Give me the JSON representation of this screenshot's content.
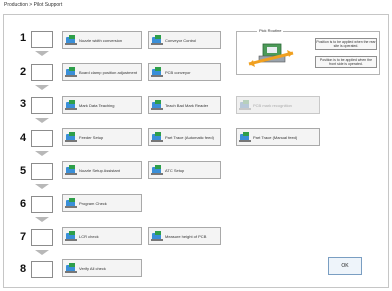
{
  "window": {
    "title": "Production > Pilot Support"
  },
  "steps": [
    {
      "number": "1"
    },
    {
      "number": "2"
    },
    {
      "number": "3"
    },
    {
      "number": "4"
    },
    {
      "number": "5"
    },
    {
      "number": "6"
    },
    {
      "number": "7"
    },
    {
      "number": "8"
    }
  ],
  "buttons": {
    "nozzle_camera": {
      "label": "Nozzle width conversion",
      "icon": "nozzle-camera-icon"
    },
    "conveyor_control": {
      "label": "Conveyor Control",
      "icon": "conveyor-icon"
    },
    "board_clamp": {
      "label": "Board clamp position adjustment",
      "icon": "board-clamp-icon"
    },
    "pcb_conveyor": {
      "label": "PCB conveyor",
      "icon": "pcb-conveyor-icon"
    },
    "mark_data_teaching": {
      "label": "Mark Data Teaching",
      "icon": "mark-teaching-icon"
    },
    "teach_bad_mark": {
      "label": "Teach Bad Mark Reader",
      "icon": "bad-mark-icon"
    },
    "pcb_recognition": {
      "label": "PCB mark recognition",
      "icon": "pcb-recognition-icon"
    },
    "feeder_setup": {
      "label": "Feeder Setup",
      "icon": "feeder-icon"
    },
    "part_trace_auto": {
      "label": "Part Trace (Automatic feed)",
      "icon": "part-trace-auto-icon"
    },
    "part_trace_manual": {
      "label": "Part Trace (Manual feed)",
      "icon": "part-trace-manual-icon"
    },
    "nozzle_setup": {
      "label": "Nozzle Setup Assistant",
      "icon": "nozzle-setup-icon"
    },
    "atc_setup": {
      "label": "ATC Setup",
      "icon": "atc-icon"
    },
    "program_check": {
      "label": "Program Check",
      "icon": "program-check-icon"
    },
    "lcr_check": {
      "label": "LCR check",
      "icon": "lcr-icon"
    },
    "measure_height": {
      "label": "Measure height of PCB",
      "icon": "measure-height-icon"
    },
    "verify_all": {
      "label": "Verify All check",
      "icon": "verify-icon"
    }
  },
  "legend": {
    "title": "Pick Routine",
    "item1": "Position is to be applied when the rear site is operated.",
    "item2": "Position is to be applied when the front side is operated."
  },
  "ok_label": "OK",
  "colors": {
    "arrow": "#b8b8b8",
    "accent_blue": "#3a8fd8",
    "accent_green": "#2e9f4a",
    "legend_arrow": "#f0a020"
  }
}
